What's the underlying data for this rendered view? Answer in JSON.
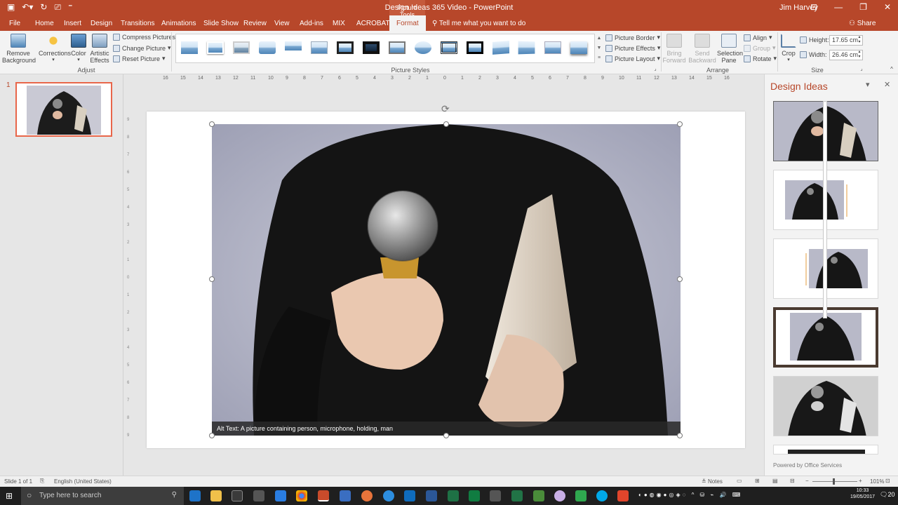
{
  "window": {
    "title": "Design Ideas 365 Video  -  PowerPoint",
    "context_tab": "Picture Tools",
    "user": "Jim Harvey"
  },
  "tabs": [
    "File",
    "Home",
    "Insert",
    "Design",
    "Transitions",
    "Animations",
    "Slide Show",
    "Review",
    "View",
    "Add-ins",
    "MIX",
    "ACROBAT",
    "Format"
  ],
  "active_tab": "Format",
  "tell_me": "Tell me what you want to do",
  "share": "Share",
  "ribbon": {
    "remove_bg": [
      "Remove",
      "Background"
    ],
    "corrections": "Corrections",
    "color": "Color",
    "artistic": [
      "Artistic",
      "Effects"
    ],
    "compress": "Compress Pictures",
    "change": "Change Picture",
    "reset": "Reset Picture",
    "adjust_group": "Adjust",
    "styles_group": "Picture Styles",
    "border": "Picture Border",
    "effects": "Picture Effects",
    "layout": "Picture Layout",
    "bring_forward": [
      "Bring",
      "Forward"
    ],
    "send_backward": [
      "Send",
      "Backward"
    ],
    "selection_pane": [
      "Selection",
      "Pane"
    ],
    "align": "Align",
    "group": "Group",
    "rotate": "Rotate",
    "arrange_group": "Arrange",
    "crop": "Crop",
    "height_label": "Height:",
    "height_value": "17.65 cm",
    "width_label": "Width:",
    "width_value": "26.46 cm",
    "size_group": "Size"
  },
  "ruler_h": [
    "16",
    "15",
    "14",
    "13",
    "12",
    "11",
    "10",
    "9",
    "8",
    "7",
    "6",
    "5",
    "4",
    "3",
    "2",
    "1",
    "0",
    "1",
    "2",
    "3",
    "4",
    "5",
    "6",
    "7",
    "8",
    "9",
    "10",
    "11",
    "12",
    "13",
    "14",
    "15",
    "16"
  ],
  "ruler_v": [
    "9",
    "8",
    "7",
    "6",
    "5",
    "4",
    "3",
    "2",
    "1",
    "0",
    "1",
    "2",
    "3",
    "4",
    "5",
    "6",
    "7",
    "8",
    "9"
  ],
  "slide_number": "1",
  "alt_text": "Alt Text: A picture containing  person, microphone, holding, man",
  "design_pane": {
    "title": "Design Ideas",
    "footer": "Powered by Office Services"
  },
  "status": {
    "slide": "Slide 1 of 1",
    "language": "English (United States)",
    "notes": "Notes",
    "zoom": "101%"
  },
  "taskbar": {
    "search": "Type here to search",
    "time": "10:33",
    "date": "19/05/2017",
    "notif": "20"
  }
}
